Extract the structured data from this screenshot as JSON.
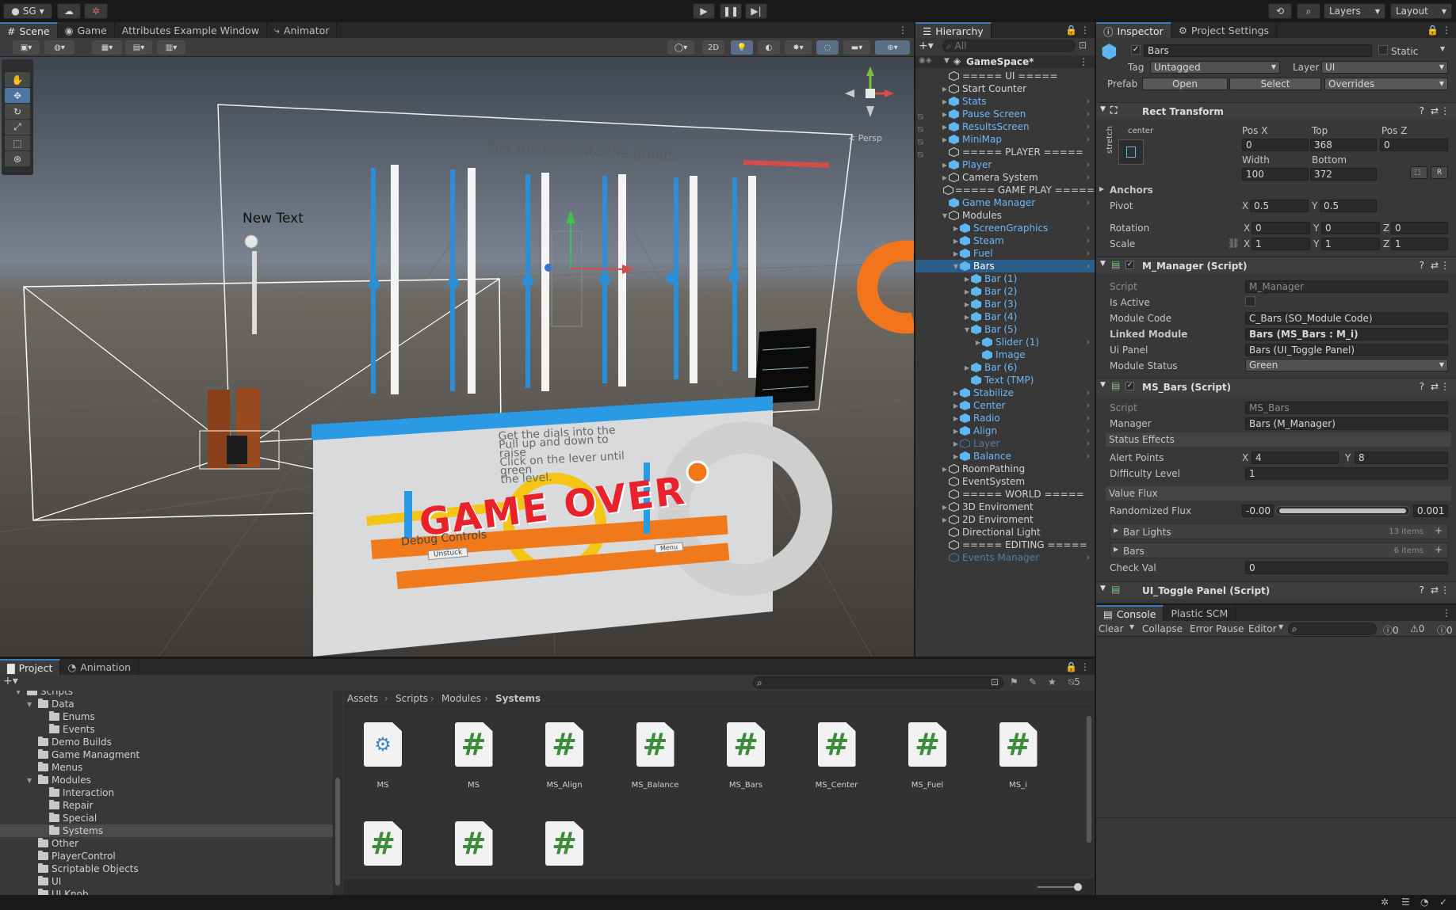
{
  "topbar": {
    "account": "SG",
    "layers": "Layers",
    "layout": "Layout"
  },
  "scene": {
    "tabs": [
      "Scene",
      "Game",
      "Attributes Example Window",
      "Animator"
    ],
    "toolbar_2d": "2D",
    "persp": "< Persp",
    "overlay_texts": {
      "instruction": "Get the bars into the green.",
      "new_text": "New Text",
      "game_over": "GAME OVER",
      "debug": "Debug Controls",
      "unstuck": "Unstuck",
      "menu": "Menu",
      "stacked_1": "Get the dials into the",
      "stacked_2": "Pull up and down to raise",
      "stacked_3": "Click on the lever until green",
      "stacked_4": "the level."
    }
  },
  "hierarchy": {
    "title": "Hierarchy",
    "search_placeholder": "All",
    "root": "GameSpace*",
    "items": [
      {
        "label": "===== UI =====",
        "indent": 1,
        "type": "go",
        "arrow": false,
        "chev": false
      },
      {
        "label": "Start Counter",
        "indent": 1,
        "type": "go",
        "arrow": true,
        "chev": false
      },
      {
        "label": "Stats",
        "indent": 1,
        "type": "prefab",
        "arrow": true,
        "chev": true
      },
      {
        "label": "Pause Screen",
        "indent": 1,
        "type": "prefab",
        "arrow": true,
        "chev": true
      },
      {
        "label": "ResultsScreen",
        "indent": 1,
        "type": "prefab",
        "arrow": true,
        "chev": true
      },
      {
        "label": "MiniMap",
        "indent": 1,
        "type": "prefab",
        "arrow": true,
        "chev": true
      },
      {
        "label": "===== PLAYER =====",
        "indent": 1,
        "type": "go",
        "arrow": false,
        "chev": false
      },
      {
        "label": "Player",
        "indent": 1,
        "type": "prefab",
        "arrow": true,
        "chev": true
      },
      {
        "label": "Camera System",
        "indent": 1,
        "type": "go",
        "arrow": true,
        "chev": true
      },
      {
        "label": "===== GAME PLAY =====",
        "indent": 1,
        "type": "go",
        "arrow": false,
        "chev": false
      },
      {
        "label": "Game Manager",
        "indent": 1,
        "type": "prefab",
        "arrow": false,
        "chev": true
      },
      {
        "label": "Modules",
        "indent": 1,
        "type": "go",
        "arrow": "open",
        "chev": false
      },
      {
        "label": "ScreenGraphics",
        "indent": 2,
        "type": "prefab",
        "arrow": true,
        "chev": true
      },
      {
        "label": "Steam",
        "indent": 2,
        "type": "prefab",
        "arrow": true,
        "chev": true
      },
      {
        "label": "Fuel",
        "indent": 2,
        "type": "prefab",
        "arrow": true,
        "chev": true
      },
      {
        "label": "Bars",
        "indent": 2,
        "type": "prefab",
        "arrow": "open",
        "chev": true,
        "selected": true
      },
      {
        "label": "Bar (1)",
        "indent": 3,
        "type": "prefab",
        "arrow": true,
        "chev": false
      },
      {
        "label": "Bar (2)",
        "indent": 3,
        "type": "prefab",
        "arrow": true,
        "chev": false
      },
      {
        "label": "Bar (3)",
        "indent": 3,
        "type": "prefab",
        "arrow": true,
        "chev": false
      },
      {
        "label": "Bar (4)",
        "indent": 3,
        "type": "prefab",
        "arrow": true,
        "chev": false
      },
      {
        "label": "Bar (5)",
        "indent": 3,
        "type": "prefab",
        "arrow": "open",
        "chev": false
      },
      {
        "label": "Slider (1)",
        "indent": 4,
        "type": "prefab",
        "arrow": true,
        "chev": true
      },
      {
        "label": "Image",
        "indent": 4,
        "type": "prefab",
        "arrow": false,
        "chev": false
      },
      {
        "label": "Bar (6)",
        "indent": 3,
        "type": "prefab",
        "arrow": true,
        "chev": false
      },
      {
        "label": "Text (TMP)",
        "indent": 3,
        "type": "prefab",
        "arrow": false,
        "chev": false
      },
      {
        "label": "Stabilize",
        "indent": 2,
        "type": "prefab",
        "arrow": true,
        "chev": true
      },
      {
        "label": "Center",
        "indent": 2,
        "type": "prefab",
        "arrow": true,
        "chev": true
      },
      {
        "label": "Radio",
        "indent": 2,
        "type": "prefab",
        "arrow": true,
        "chev": true
      },
      {
        "label": "Align",
        "indent": 2,
        "type": "prefab",
        "arrow": true,
        "chev": true
      },
      {
        "label": "Layer",
        "indent": 2,
        "type": "dim",
        "arrow": true,
        "chev": true
      },
      {
        "label": "Balance",
        "indent": 2,
        "type": "prefab",
        "arrow": true,
        "chev": true
      },
      {
        "label": "RoomPathing",
        "indent": 1,
        "type": "go",
        "arrow": true,
        "chev": false
      },
      {
        "label": "EventSystem",
        "indent": 1,
        "type": "go",
        "arrow": false,
        "chev": false
      },
      {
        "label": "===== WORLD =====",
        "indent": 1,
        "type": "go",
        "arrow": false,
        "chev": false
      },
      {
        "label": "3D Enviroment",
        "indent": 1,
        "type": "go",
        "arrow": true,
        "chev": false
      },
      {
        "label": "2D Enviroment",
        "indent": 1,
        "type": "go",
        "arrow": true,
        "chev": false
      },
      {
        "label": "Directional Light",
        "indent": 1,
        "type": "go",
        "arrow": false,
        "chev": false
      },
      {
        "label": "===== EDITING =====",
        "indent": 1,
        "type": "go",
        "arrow": false,
        "chev": false
      },
      {
        "label": "Events Manager",
        "indent": 1,
        "type": "dim",
        "arrow": false,
        "chev": true
      }
    ]
  },
  "inspector": {
    "tabs": [
      "Inspector",
      "Project Settings"
    ],
    "object_name": "Bars",
    "static": "Static",
    "tag_label": "Tag",
    "tag": "Untagged",
    "layer_label": "Layer",
    "layer": "UI",
    "prefab_label": "Prefab",
    "open": "Open",
    "select": "Select",
    "overrides": "Overrides",
    "rect_transform": {
      "title": "Rect Transform",
      "anchor_h": "center",
      "anchor_v": "stretch",
      "posx_label": "Pos X",
      "top_label": "Top",
      "posz_label": "Pos Z",
      "posx": "0",
      "top": "368",
      "posz": "0",
      "width_label": "Width",
      "bottom_label": "Bottom",
      "width": "100",
      "bottom": "372",
      "r_btn": "R",
      "anchors": "Anchors",
      "pivot": "Pivot",
      "pivot_x": "0.5",
      "pivot_y": "0.5",
      "rotation": "Rotation",
      "rot_x": "0",
      "rot_y": "0",
      "rot_z": "0",
      "scale": "Scale",
      "scale_x": "1",
      "scale_y": "1",
      "scale_z": "1",
      "x": "X",
      "y": "Y",
      "z": "Z"
    },
    "m_manager": {
      "title": "M_Manager (Script)",
      "script_label": "Script",
      "script": "M_Manager",
      "is_active": "Is Active",
      "module_code_label": "Module Code",
      "module_code": "C_Bars (SO_Module Code)",
      "linked_module_label": "Linked Module",
      "linked_module": "Bars (MS_Bars : M_i)",
      "ui_panel_label": "Ui Panel",
      "ui_panel": "Bars (UI_Toggle Panel)",
      "module_status_label": "Module Status",
      "module_status": "Green"
    },
    "ms_bars": {
      "title": "MS_Bars (Script)",
      "script_label": "Script",
      "script": "MS_Bars",
      "manager_label": "Manager",
      "manager": "Bars (M_Manager)",
      "status_effects": "Status Effects",
      "alert_points_label": "Alert Points",
      "alert_x": "4",
      "alert_y": "8",
      "difficulty_label": "Difficulty Level",
      "difficulty": "1",
      "value_flux": "Value Flux",
      "randomized_flux_label": "Randomized Flux",
      "flux_min": "-0.00",
      "flux_max": "0.001",
      "bar_lights": "Bar Lights",
      "bar_lights_count": "13 items",
      "bars": "Bars",
      "bars_count": "6 items",
      "check_val_label": "Check Val",
      "check_val": "0"
    },
    "ui_toggle": {
      "title": "UI_Toggle Panel (Script)"
    }
  },
  "console": {
    "tabs": [
      "Console",
      "Plastic SCM"
    ],
    "clear": "Clear",
    "collapse": "Collapse",
    "error_pause": "Error Pause",
    "editor": "Editor",
    "count_logs": "0",
    "count_warn": "0",
    "count_err": "0"
  },
  "project": {
    "tabs": [
      "Project",
      "Animation"
    ],
    "hidden_count": "5",
    "breadcrumb": [
      "Assets",
      "Scripts",
      "Modules",
      "Systems"
    ],
    "tree": [
      {
        "label": "Scripts",
        "indent": 1,
        "open": true
      },
      {
        "label": "Data",
        "indent": 2,
        "open": true
      },
      {
        "label": "Enums",
        "indent": 3,
        "open": false
      },
      {
        "label": "Events",
        "indent": 3,
        "open": false
      },
      {
        "label": "Demo Builds",
        "indent": 2,
        "open": false
      },
      {
        "label": "Game Managment",
        "indent": 2,
        "open": false
      },
      {
        "label": "Menus",
        "indent": 2,
        "open": false
      },
      {
        "label": "Modules",
        "indent": 2,
        "open": true
      },
      {
        "label": "Interaction",
        "indent": 3,
        "open": false
      },
      {
        "label": "Repair",
        "indent": 3,
        "open": false
      },
      {
        "label": "Special",
        "indent": 3,
        "open": false
      },
      {
        "label": "Systems",
        "indent": 3,
        "open": false,
        "selected": true
      },
      {
        "label": "Other",
        "indent": 2,
        "open": false
      },
      {
        "label": "PlayerControl",
        "indent": 2,
        "open": false
      },
      {
        "label": "Scriptable Objects",
        "indent": 2,
        "open": false
      },
      {
        "label": "UI",
        "indent": 2,
        "open": false
      },
      {
        "label": "UI Knob",
        "indent": 2,
        "open": false
      }
    ],
    "assets": [
      {
        "name": "MS",
        "kind": "asmdef"
      },
      {
        "name": "MS",
        "kind": "cs"
      },
      {
        "name": "MS_Align",
        "kind": "cs"
      },
      {
        "name": "MS_Balance",
        "kind": "cs"
      },
      {
        "name": "MS_Bars",
        "kind": "cs"
      },
      {
        "name": "MS_Center",
        "kind": "cs"
      },
      {
        "name": "MS_Fuel",
        "kind": "cs"
      },
      {
        "name": "MS_i",
        "kind": "cs"
      },
      {
        "name": "",
        "kind": "cs"
      },
      {
        "name": "",
        "kind": "cs"
      },
      {
        "name": "",
        "kind": "cs"
      }
    ],
    "asset_glyph": "#"
  }
}
